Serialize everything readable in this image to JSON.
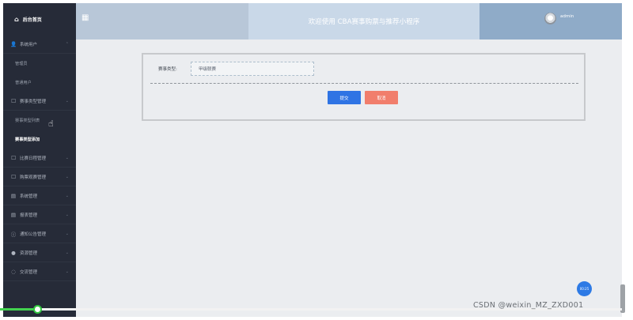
{
  "sidebar": {
    "brand": "后台首页",
    "groups": [
      {
        "icon": "person-icon",
        "glyph": "👤",
        "label": "系统用户",
        "items": [
          "管理员",
          "普通用户"
        ]
      },
      {
        "icon": "folder-icon",
        "glyph": "☐",
        "label": "赛事类型管理",
        "items": [
          "赛事类型列表",
          "赛事类型添加"
        ]
      },
      {
        "icon": "folder-icon",
        "glyph": "☐",
        "label": "比赛日程管理",
        "items": []
      },
      {
        "icon": "folder-icon",
        "glyph": "☐",
        "label": "购票观赛管理",
        "items": []
      },
      {
        "icon": "monitor-icon",
        "glyph": "▤",
        "label": "系统管理",
        "items": []
      },
      {
        "icon": "monitor-icon",
        "glyph": "▤",
        "label": "报表管理",
        "items": []
      },
      {
        "icon": "info-icon",
        "glyph": "ⓘ",
        "label": "通知公告管理",
        "items": []
      },
      {
        "icon": "location-icon",
        "glyph": "●",
        "label": "资源管理",
        "items": []
      },
      {
        "icon": "chat-icon",
        "glyph": "◌",
        "label": "交流管理",
        "items": []
      }
    ],
    "active_item": "赛事类型添加"
  },
  "header": {
    "title": "欢迎使用 CBA赛事购票与推荐小程序",
    "username": "admin"
  },
  "form": {
    "field_label": "赛事类型:",
    "field_value": "甲级联赛",
    "submit_label": "提交",
    "cancel_label": "取消"
  },
  "badge_text": "00:25",
  "video_progress": 0.06,
  "watermark": "CSDN @weixin_MZ_ZXD001",
  "colors": {
    "sidebar_bg": "#262b38",
    "header_bg": "#b8c7d8",
    "submit": "#2f74e4",
    "cancel": "#f17e6c",
    "progress": "#43d24f"
  }
}
